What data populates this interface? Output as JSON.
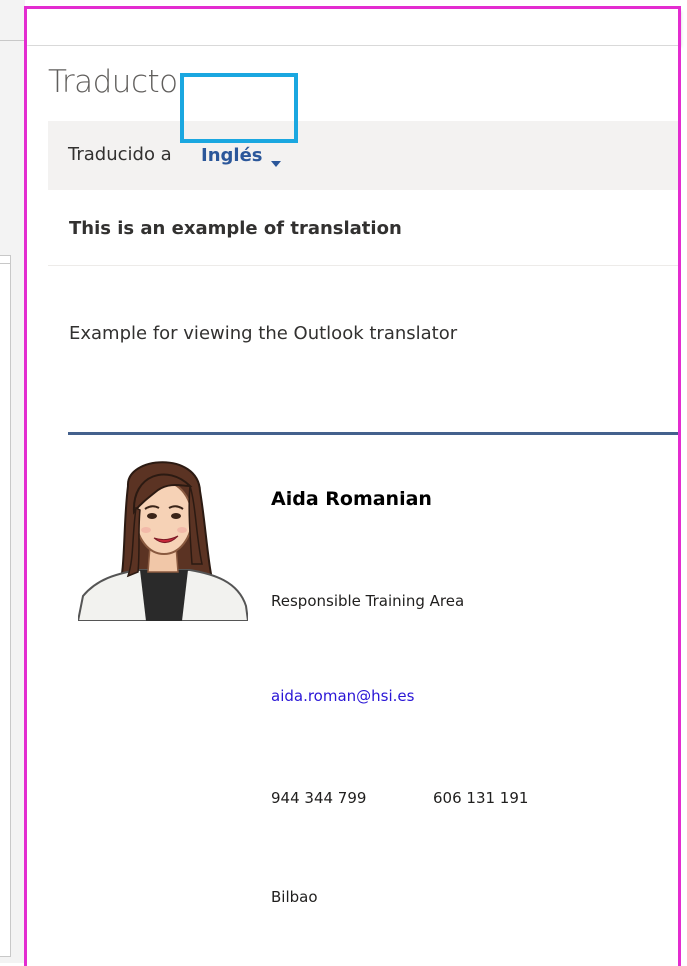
{
  "pane": {
    "title": "Traductor"
  },
  "translation_bar": {
    "prefix": "Traducido a",
    "language": "Inglés",
    "dropdown_icon": "chevron-down-icon"
  },
  "message": {
    "subject": "This is an example of translation",
    "body": "Example for viewing the Outlook translator"
  },
  "signature": {
    "name": "Aida Romanian",
    "role": "Responsible Training Area",
    "email": "aida.roman@hsi.es",
    "phone_1": "944 344 799",
    "phone_2": "606 131 191",
    "city": "Bilbao"
  },
  "colors": {
    "highlight_frame": "#e32cd0",
    "language_highlight": "#1aa7e0",
    "language_link": "#2b579a",
    "signature_rule": "#44618d",
    "email_link": "#2a16d6"
  }
}
